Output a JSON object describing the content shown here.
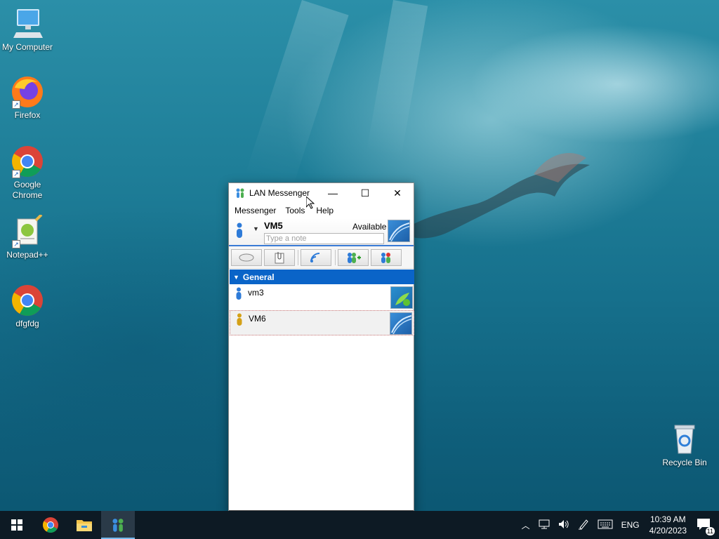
{
  "desktop": {
    "icons": [
      {
        "label": "My Computer",
        "icon": "monitor-icon"
      },
      {
        "label": "Firefox",
        "icon": "firefox-icon"
      },
      {
        "label": "Google Chrome",
        "icon": "chrome-icon"
      },
      {
        "label": "Notepad++",
        "icon": "notepadpp-icon"
      },
      {
        "label": "dfgfdg",
        "icon": "chrome-icon"
      },
      {
        "label": "Recycle Bin",
        "icon": "recycle-bin-icon"
      }
    ]
  },
  "window": {
    "title": "LAN Messenger",
    "controls": {
      "minimize": "—",
      "maximize": "☐",
      "close": "✕"
    },
    "menu": [
      "Messenger",
      "Tools",
      "Help"
    ],
    "profile": {
      "name": "VM5",
      "status": "Available",
      "note_placeholder": "Type a note"
    },
    "toolbar": [
      {
        "icon": "chat-icon"
      },
      {
        "icon": "file-transfer-icon"
      },
      {
        "icon": "broadcast-icon"
      },
      {
        "icon": "add-contact-icon"
      },
      {
        "icon": "contacts-settings-icon"
      }
    ],
    "group": {
      "name": "General",
      "expanded": true
    },
    "contacts": [
      {
        "name": "vm3",
        "status_color": "#2e7bd8"
      },
      {
        "name": "VM6",
        "status_color": "#d4a017"
      }
    ]
  },
  "taskbar": {
    "apps": [
      "start-icon",
      "chrome-icon",
      "file-explorer-icon",
      "lan-messenger-icon"
    ],
    "tray": {
      "language": "ENG",
      "time": "10:39 AM",
      "date": "4/20/2023",
      "notifications": "11"
    }
  }
}
